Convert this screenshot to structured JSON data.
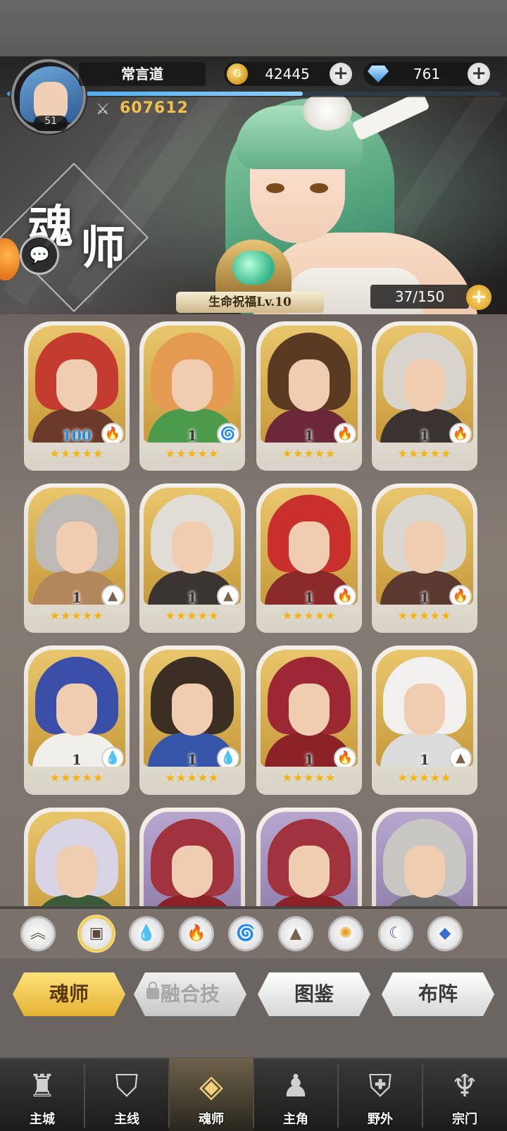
{
  "player": {
    "name": "常言道",
    "level": "51",
    "power": "607612",
    "xp_fraction": 0.6
  },
  "currency": {
    "gold": "42445",
    "gold_icon": "coin-icon",
    "diamond": "761",
    "diamond_icon": "diamond-icon",
    "plus": "+"
  },
  "page": {
    "title_char_1": "魂",
    "title_char_2": "师"
  },
  "blessing": {
    "label": "生命祝福Lv.10"
  },
  "roster": {
    "capacity": "37/150",
    "capacity_plus": "+"
  },
  "colors": {
    "gold_accent": "#f0c14a",
    "level_max": "#1e8fd8",
    "star": "#f5b40b",
    "fire": "#e0463a",
    "water": "#2e8ad8",
    "wind": "#2ea86a",
    "earth": "#7a6450",
    "light": "#e8a21a",
    "dark": "#6b4fb3",
    "void": "#3a6bd0"
  },
  "cards": [
    {
      "level": "100",
      "element": "fire-icon",
      "stars": "★★★★★",
      "hair": "#c43b2f",
      "body": "#6b3a2a",
      "frame": "gold"
    },
    {
      "level": "1",
      "element": "wind-icon",
      "stars": "★★★★★",
      "hair": "#e59a52",
      "body": "#4c9a4c",
      "frame": "gold"
    },
    {
      "level": "1",
      "element": "fire-icon",
      "stars": "★★★★★",
      "hair": "#5b3a24",
      "body": "#6a2838",
      "frame": "gold"
    },
    {
      "level": "1",
      "element": "fire-icon",
      "stars": "★★★★★",
      "hair": "#d8d4cc",
      "body": "#3a3330",
      "frame": "gold"
    },
    {
      "level": "1",
      "element": "earth-icon",
      "stars": "★★★★★",
      "hair": "#bdbab5",
      "body": "#b3875c",
      "frame": "gold"
    },
    {
      "level": "1",
      "element": "earth-icon",
      "stars": "★★★★★",
      "hair": "#e0dcd6",
      "body": "#3a3530",
      "frame": "gold"
    },
    {
      "level": "1",
      "element": "fire-icon",
      "stars": "★★★★★",
      "hair": "#c8302e",
      "body": "#8a2a2a",
      "frame": "gold"
    },
    {
      "level": "1",
      "element": "fire-icon",
      "stars": "★★★★★",
      "hair": "#dad7d1",
      "body": "#5a3a30",
      "frame": "gold"
    },
    {
      "level": "1",
      "element": "water-icon",
      "stars": "★★★★★",
      "hair": "#3b4fa8",
      "body": "#f1efe9",
      "frame": "gold"
    },
    {
      "level": "1",
      "element": "water-icon",
      "stars": "★★★★★",
      "hair": "#3b2f24",
      "body": "#3556a8",
      "frame": "gold"
    },
    {
      "level": "1",
      "element": "fire-icon",
      "stars": "★★★★★",
      "hair": "#9c2834",
      "body": "#8a2228",
      "frame": "gold"
    },
    {
      "level": "1",
      "element": "earth-icon",
      "stars": "★★★★★",
      "hair": "#f1f0ee",
      "body": "#dcdcdc",
      "frame": "gold"
    },
    {
      "level": "",
      "element": "",
      "stars": "",
      "hair": "#d9d3e6",
      "body": "#3a5a3a",
      "frame": "gold"
    },
    {
      "level": "",
      "element": "",
      "stars": "",
      "hair": "#a0333b",
      "body": "#8a2228",
      "frame": "purple"
    },
    {
      "level": "",
      "element": "",
      "stars": "",
      "hair": "#a0333b",
      "body": "#8a2228",
      "frame": "purple"
    },
    {
      "level": "",
      "element": "",
      "stars": "",
      "hair": "#c9c7c3",
      "body": "#6a6a6a",
      "frame": "purple"
    }
  ],
  "element_glyphs": {
    "fire-icon": "🔥",
    "water-icon": "💧",
    "wind-icon": "🌀",
    "earth-icon": "▲",
    "light-icon": "✺",
    "dark-icon": "☾",
    "void-icon": "◆"
  },
  "filters": [
    {
      "name": "sort-chevron-icon",
      "glyph": "︽",
      "active": false
    },
    {
      "name": "all-box-icon",
      "glyph": "▣",
      "active": true
    },
    {
      "name": "water-icon",
      "glyph": "💧",
      "active": false
    },
    {
      "name": "fire-icon",
      "glyph": "🔥",
      "active": false
    },
    {
      "name": "wind-icon",
      "glyph": "🌀",
      "active": false
    },
    {
      "name": "earth-icon",
      "glyph": "▲",
      "active": false
    },
    {
      "name": "light-icon",
      "glyph": "✺",
      "active": false
    },
    {
      "name": "dark-icon",
      "glyph": "☾",
      "active": false
    },
    {
      "name": "void-icon",
      "glyph": "◆",
      "active": false
    }
  ],
  "tabs": [
    {
      "label": "魂师",
      "state": "active"
    },
    {
      "label": "融合技",
      "state": "locked"
    },
    {
      "label": "图鉴",
      "state": "normal"
    },
    {
      "label": "布阵",
      "state": "normal"
    }
  ],
  "nav": [
    {
      "label": "主城",
      "icon": "castle-icon",
      "glyph": "♜",
      "active": false
    },
    {
      "label": "主线",
      "icon": "mainline-icon",
      "glyph": "⛉",
      "active": false
    },
    {
      "label": "魂师",
      "icon": "soul-master-icon",
      "glyph": "◈",
      "active": true
    },
    {
      "label": "主角",
      "icon": "hero-icon",
      "glyph": "♟",
      "active": false
    },
    {
      "label": "野外",
      "icon": "wild-icon",
      "glyph": "⛨",
      "active": false
    },
    {
      "label": "宗门",
      "icon": "sect-icon",
      "glyph": "♆",
      "active": false
    }
  ]
}
